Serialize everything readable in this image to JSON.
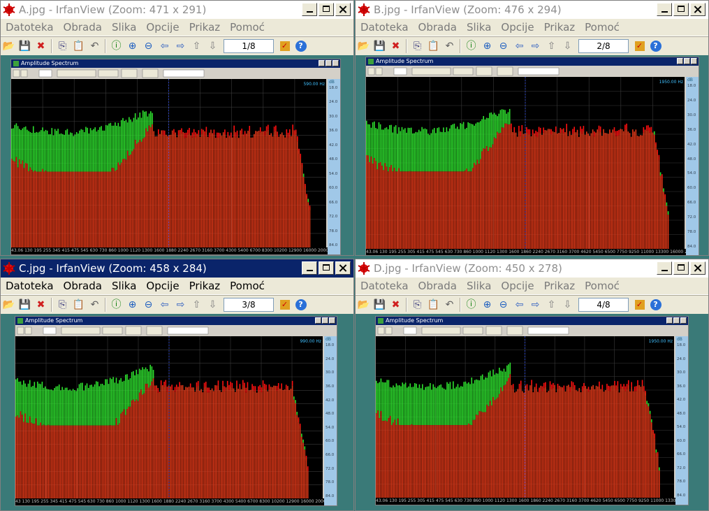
{
  "menu_labels": [
    "Datoteka",
    "Obrada",
    "Slika",
    "Opcije",
    "Prikaz",
    "Pomoć"
  ],
  "toolbar_icons": [
    "open-icon",
    "save-icon",
    "delete-icon",
    "copy-icon",
    "paste-icon",
    "undo-icon",
    "info-icon",
    "zoom-in-icon",
    "zoom-out-icon",
    "previous-icon",
    "next-icon",
    "previous-page-icon",
    "next-page-icon",
    "page-input",
    "properties-icon",
    "help-icon"
  ],
  "windows": [
    {
      "title": "A.jpg - IrfanView (Zoom: 471 x 291)",
      "page": "1/8",
      "active": false,
      "spectrum": {
        "title": "Amplitude Spectrum",
        "readout": "590.00 Hz",
        "unit": "dB",
        "y_labels": [
          "18.0",
          "24.0",
          "30.0",
          "36.0",
          "42.0",
          "48.0",
          "54.0",
          "60.0",
          "66.0",
          "72.0",
          "78.0",
          "84.0"
        ],
        "x_labels": "43.06 130 195 255 345 415 475 545 630 730 860 1000 1120 1300 1600 1880 2240 2670 3160 3700 4300 5400 6700 8300 10200 12900 16000 20000"
      }
    },
    {
      "title": "B.jpg - IrfanView (Zoom: 476 x 294)",
      "page": "2/8",
      "active": false,
      "spectrum": {
        "title": "Amplitude Spectrum",
        "readout": "1950.00 Hz",
        "unit": "dB",
        "y_labels": [
          "18.0",
          "24.0",
          "30.0",
          "36.0",
          "42.0",
          "48.0",
          "54.0",
          "60.0",
          "66.0",
          "72.0",
          "78.0",
          "84.0"
        ],
        "x_labels": "43.06 130 195 255 305 415 475 545 630 730 860 1000 1120 1300 1600 1860 2240 2670 3160 3700 4620 5450 6500 7750 9250 11000 13300 16000 20000"
      }
    },
    {
      "title": "C.jpg - IrfanView (Zoom: 458 x 284)",
      "page": "3/8",
      "active": true,
      "spectrum": {
        "title": "Amplitude Spectrum",
        "readout": "990.00 Hz",
        "unit": "dB",
        "y_labels": [
          "18.0",
          "24.0",
          "30.0",
          "36.0",
          "42.0",
          "48.0",
          "54.0",
          "60.0",
          "66.0",
          "72.0",
          "78.0",
          "84.0"
        ],
        "x_labels": "43 130 195 255 345 415 475 545 630 730 860 1000 1120 1300 1600 1880 2240 2670 3160 3700 4300 5400 6700 8300 10200 12900 16000 20000"
      }
    },
    {
      "title": "D.jpg - IrfanView (Zoom: 450 x 278)",
      "page": "4/8",
      "active": false,
      "spectrum": {
        "title": "Amplitude Spectrum",
        "readout": "1950.00 Hz",
        "unit": "dB",
        "y_labels": [
          "18.0",
          "24.0",
          "30.0",
          "36.0",
          "42.0",
          "48.0",
          "54.0",
          "60.0",
          "66.0",
          "72.0",
          "78.0",
          "84.0"
        ],
        "x_labels": "43.06 130 195 255 305 415 475 545 630 730 860 1000 1120 1300 1600 1860 2240 2670 3160 3700 4620 5450 6500 7750 9250 11000 13300 16000 20000"
      }
    }
  ]
}
